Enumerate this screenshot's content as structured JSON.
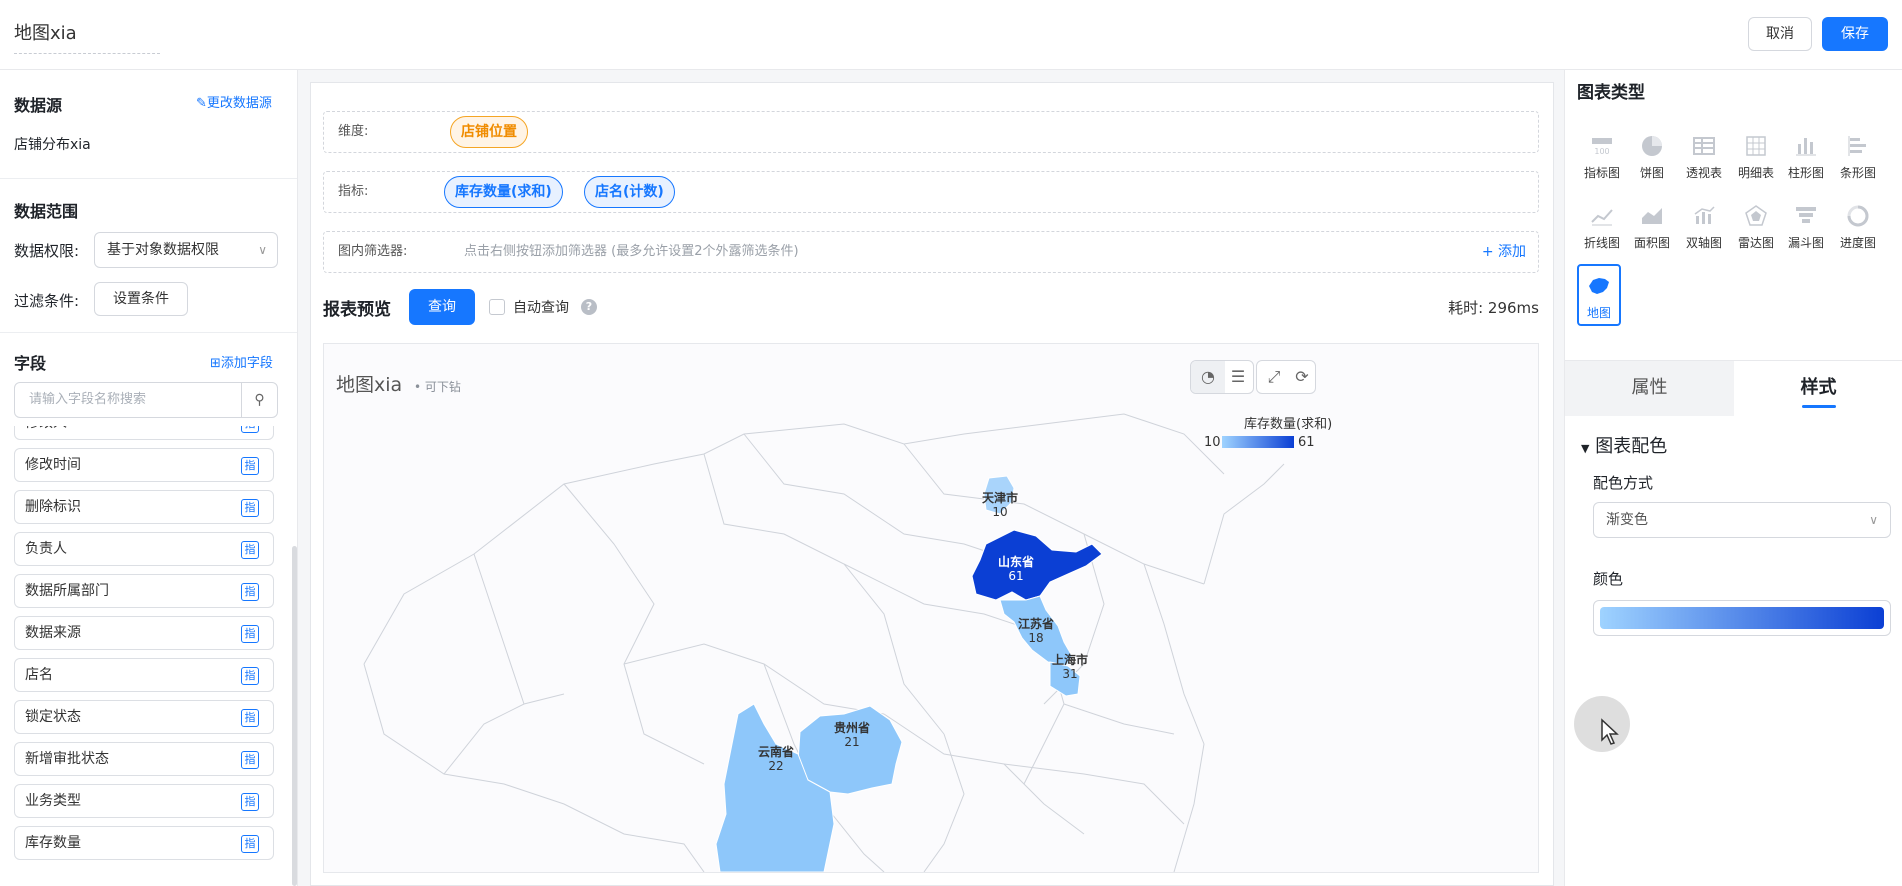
{
  "header": {
    "title": "地图xia",
    "cancel_label": "取消",
    "save_label": "保存"
  },
  "datasource": {
    "title": "数据源",
    "change_label": "更改数据源",
    "name": "店铺分布xia"
  },
  "data_range": {
    "title": "数据范围",
    "perm_label": "数据权限:",
    "perm_value": "基于对象数据权限",
    "filter_label": "过滤条件:",
    "filter_button": "设置条件"
  },
  "fields": {
    "title": "字段",
    "add_label": "添加字段",
    "search_placeholder": "请输入字段名称搜索",
    "tag": "指",
    "items": [
      "修改人",
      "修改时间",
      "删除标识",
      "负责人",
      "数据所属部门",
      "数据来源",
      "店名",
      "锁定状态",
      "新增审批状态",
      "业务类型",
      "库存数量"
    ]
  },
  "config": {
    "dimension_label": "维度:",
    "dimension_pill": "店铺位置",
    "metric_label": "指标:",
    "metric_pills": [
      "库存数量(求和)",
      "店名(计数)"
    ],
    "filter_label": "图内筛选器:",
    "filter_hint": "点击右侧按钮添加筛选器 (最多允许设置2个外露筛选条件)",
    "filter_add": "+ 添加"
  },
  "preview": {
    "title": "报表预览",
    "query_label": "查询",
    "auto_label": "自动查询",
    "elapsed": "耗时: 296ms"
  },
  "chart": {
    "name": "地图xia",
    "drill": "• 可下钻",
    "legend_title": "库存数量(求和)",
    "legend_min": "10",
    "legend_max": "61"
  },
  "chart_data": {
    "type": "map",
    "series": [
      {
        "name": "库存数量(求和)",
        "values": [
          {
            "region": "天津市",
            "value": 10
          },
          {
            "region": "山东省",
            "value": 61
          },
          {
            "region": "江苏省",
            "value": 18
          },
          {
            "region": "上海市",
            "value": 31
          },
          {
            "region": "贵州省",
            "value": 21
          },
          {
            "region": "云南省",
            "value": 22
          }
        ]
      }
    ],
    "color_range": [
      "#9fd3ff",
      "#0b3fd4"
    ],
    "value_range": [
      10,
      61
    ]
  },
  "chart_types": {
    "title": "图表类型",
    "items": [
      "指标图",
      "饼图",
      "透视表",
      "明细表",
      "柱形图",
      "条形图",
      "折线图",
      "面积图",
      "双轴图",
      "雷达图",
      "漏斗图",
      "进度图",
      "地图"
    ],
    "active": "地图"
  },
  "style_panel": {
    "tab_attr": "属性",
    "tab_style": "样式",
    "section": "图表配色",
    "method_label": "配色方式",
    "method_value": "渐变色",
    "color_label": "颜色"
  }
}
